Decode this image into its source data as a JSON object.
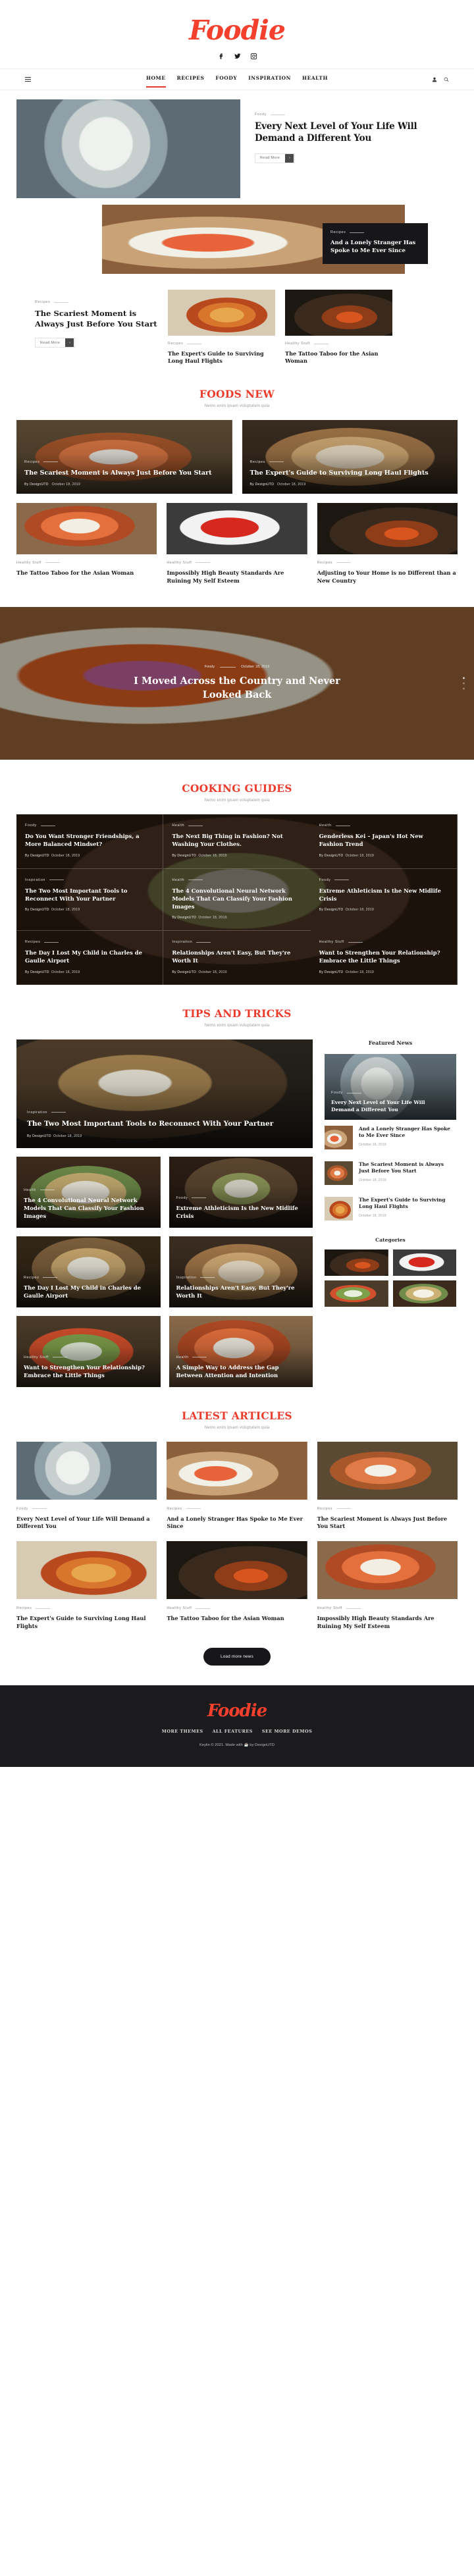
{
  "site": {
    "logo": "Foodie",
    "social": [
      "facebook-icon",
      "twitter-icon",
      "instagram-icon"
    ]
  },
  "nav": {
    "items": [
      {
        "label": "HOME",
        "active": true
      },
      {
        "label": "RECIPES",
        "active": false
      },
      {
        "label": "FOODY",
        "active": false
      },
      {
        "label": "INSPIRATION",
        "active": false
      },
      {
        "label": "HEALTH",
        "active": false
      }
    ],
    "icons": [
      "hamburger-icon",
      "user-icon",
      "search-icon"
    ]
  },
  "featured": {
    "main": {
      "category": "Foody",
      "title": "Every Next Level of Your Life Will Demand a Different You",
      "read_more": "Read More",
      "arrow": "›"
    },
    "overlay_card": {
      "category": "Recipes",
      "title": "And a Lonely Stranger Has Spoke to Me Ever Since"
    },
    "secondary": {
      "category": "Recipes",
      "title": "The Scariest Moment is Always Just Before You Start",
      "read_more": "Read More"
    },
    "minis": [
      {
        "category": "Recipes",
        "title": "The Expert's Guide to Surviving Long Haul Flights"
      },
      {
        "category": "Healthy Stuff",
        "title": "The Tattoo Taboo for the Asian Woman"
      }
    ]
  },
  "foods_new": {
    "heading": "FOODS NEW",
    "subheading": "Nemo enim ipsam voluptatem quia",
    "big_cards": [
      {
        "category": "Recipes",
        "title": "The Scariest Moment is Always Just Before You Start",
        "author": "By DesignUTD",
        "date": "October 18, 2019"
      },
      {
        "category": "Recipes",
        "title": "The Expert's Guide to Surviving Long Haul Flights",
        "author": "By DesignUTD",
        "date": "October 18, 2019"
      }
    ],
    "cards": [
      {
        "category": "Healthy Stuff",
        "title": "The Tattoo Taboo for the Asian Woman"
      },
      {
        "category": "Healthy Stuff",
        "title": "Impossibly High Beauty Standards Are Ruining My Self Esteem"
      },
      {
        "category": "Recipes",
        "title": "Adjusting to Your Home is no Different than a New Country"
      }
    ]
  },
  "banner": {
    "category": "Foody",
    "date": "October 18, 2019",
    "title": "I Moved Across the Country and Never Looked Back"
  },
  "cooking_guides": {
    "heading": "COOKING GUIDES",
    "subheading": "Nemo enim ipsam voluptatem quia",
    "cells": [
      {
        "category": "Foody",
        "title": "Do You Want Stronger Friendships, a More Balanced Mindset?",
        "author": "By DesignUTD",
        "date": "October 18, 2019"
      },
      {
        "category": "Health",
        "title": "The Next Big Thing in Fashion? Not Washing Your Clothes.",
        "author": "By DesignUTD",
        "date": "October 18, 2019"
      },
      {
        "category": "Health",
        "title": "Genderless Kei – Japan's Hot New Fashion Trend",
        "author": "By DesignUTD",
        "date": "October 18, 2019"
      },
      {
        "category": "Inspiration",
        "title": "The Two Most Important Tools to Reconnect With Your Partner",
        "author": "By DesignUTD",
        "date": "October 18, 2019"
      },
      {
        "category": "Health",
        "title": "The 4 Convolutional Neural Network Models That Can Classify Your Fashion Images",
        "author": "By DesignUTD",
        "date": "October 18, 2019"
      },
      {
        "category": "Foody",
        "title": "Extreme Athleticism Is the New Midlife Crisis",
        "author": "By DesignUTD",
        "date": "October 18, 2019"
      },
      {
        "category": "Recipes",
        "title": "The Day I Lost My Child in Charles de Gaulle Airport",
        "author": "By DesignUTD",
        "date": "October 18, 2019"
      },
      {
        "category": "Inspiration",
        "title": "Relationships Aren't Easy, But They're Worth It",
        "author": "By DesignUTD",
        "date": "October 18, 2019"
      },
      {
        "category": "Healthy Stuff",
        "title": "Want to Strengthen Your Relationship? Embrace the Little Things",
        "author": "By DesignUTD",
        "date": "October 18, 2019"
      }
    ]
  },
  "tips": {
    "heading": "TIPS AND TRICKS",
    "subheading": "Nemo enim ipsam voluptatem quia",
    "hero": {
      "category": "Inspiration",
      "title": "The Two Most Important Tools to Reconnect With Your Partner",
      "author": "By DesignUTD",
      "date": "October 18, 2019"
    },
    "cards": [
      {
        "category": "Health",
        "title": "The 4 Convolutional Neural Network Models That Can Classify Your Fashion Images"
      },
      {
        "category": "Foody",
        "title": "Extreme Athleticism Is the New Midlife Crisis"
      },
      {
        "category": "Recipes",
        "title": "The Day I Lost My Child in Charles de Gaulle Airport"
      },
      {
        "category": "Inspiration",
        "title": "Relationships Aren't Easy, But They're Worth It"
      },
      {
        "category": "Healthy Stuff",
        "title": "Want to Strengthen Your Relationship? Embrace the Little Things"
      },
      {
        "category": "Health",
        "title": "A Simple Way to Address the Gap Between Attention and Intention"
      }
    ],
    "sidebar": {
      "featured_title": "Featured News",
      "featured": {
        "category": "Foody",
        "title": "Every Next Level of Your Life Will Demand a Different You"
      },
      "items": [
        {
          "title": "And a Lonely Stranger Has Spoke to Me Ever Since",
          "date": "October 18, 2019"
        },
        {
          "title": "The Scariest Moment is Always Just Before You Start",
          "date": "October 18, 2019"
        },
        {
          "title": "The Expert's Guide to Surviving Long Haul Flights",
          "date": "October 18, 2019"
        }
      ],
      "categories_title": "Categories"
    }
  },
  "latest": {
    "heading": "LATEST ARTICLES",
    "subheading": "Nemo enim ipsam voluptatem quia",
    "cards": [
      {
        "category": "Foody",
        "title": "Every Next Level of Your Life Will Demand a Different You"
      },
      {
        "category": "Recipes",
        "title": "And a Lonely Stranger Has Spoke to Me Ever Since"
      },
      {
        "category": "Recipes",
        "title": "The Scariest Moment is Always Just Before You Start"
      },
      {
        "category": "Recipes",
        "title": "The Expert's Guide to Surviving Long Haul Flights"
      },
      {
        "category": "Healthy Stuff",
        "title": "The Tattoo Taboo for the Asian Woman"
      },
      {
        "category": "Healthy Stuff",
        "title": "Impossibly High Beauty Standards Are Ruining My Self Esteem"
      }
    ],
    "load_more": "Load more news"
  },
  "footer": {
    "logo": "Foodie",
    "links": [
      "MORE THEMES",
      "ALL FEATURES",
      "SEE MORE DEMOS"
    ],
    "copyright": "Keylin © 2021. Made with ☕ by DesignUTD"
  },
  "colors": {
    "accent": "#ec3b2b",
    "logo": "#f4402d",
    "dark": "#17171a"
  }
}
